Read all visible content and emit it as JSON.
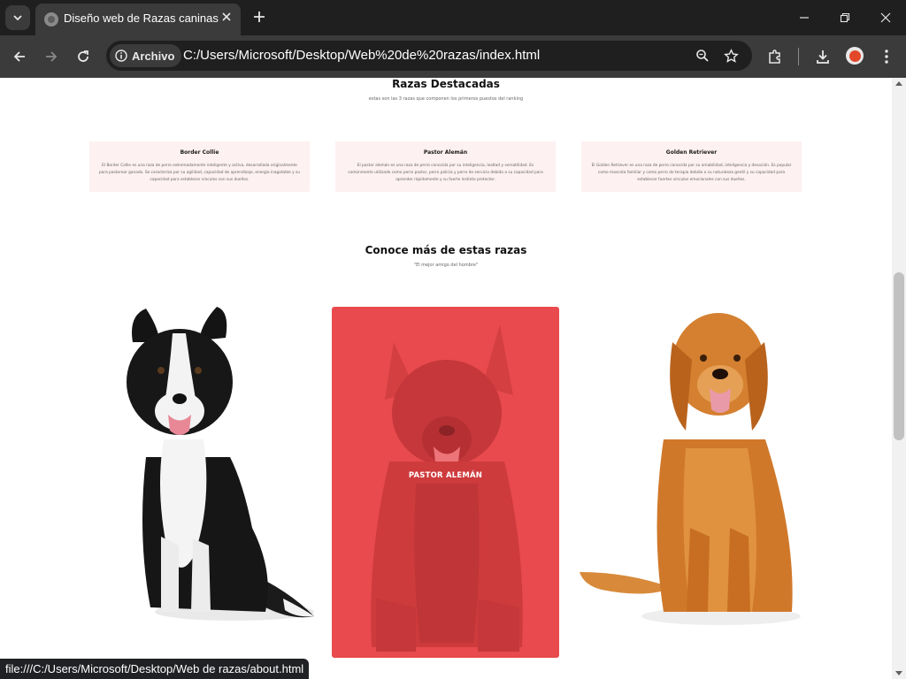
{
  "browser": {
    "tab_title": "Diseño web de Razas caninas",
    "site_chip_label": "Archivo",
    "url": "C:/Users/Microsoft/Desktop/Web%20de%20razas/index.html",
    "status_url": "file:///C:/Users/Microsoft/Desktop/Web de razas/about.html",
    "icons": [
      "tab-search-icon",
      "close-icon",
      "plus-icon",
      "minimize-icon",
      "restore-icon",
      "back-icon",
      "forward-icon",
      "reload-icon",
      "info-icon",
      "zoom-icon",
      "star-icon",
      "extensions-icon",
      "download-icon",
      "more-icon"
    ]
  },
  "page": {
    "featured_section": {
      "title": "Razas Destacadas",
      "subtitle": "estas son las 3 razas que componen los primeros puestos del ranking",
      "cards": [
        {
          "title": "Border Collie",
          "text": "El Border Collie es una raza de perro extremadamente inteligente y activa, desarrollada originalmente para pastorear ganado. Se caracteriza por su agilidad, capacidad de aprendizaje, energía inagotable y su capacidad para establecer vínculos con sus dueños."
        },
        {
          "title": "Pastor Alemán",
          "text": "El pastor alemán es una raza de perro conocida por su inteligencia, lealtad y versatilidad. Es comúnmente utilizado como perro pastor, perro policía y perro de servicio debido a su capacidad para aprender rápidamente y su fuerte instinto protector."
        },
        {
          "title": "Golden Retriever",
          "text": "El Golden Retriever es una raza de perro conocida por su amabilidad, inteligencia y devoción. Es popular como mascota familiar y como perro de terapia debido a su naturaleza gentil y su capacidad para establecer fuertes vínculos emocionales con sus dueños."
        }
      ]
    },
    "more_section": {
      "title": "Conoce más de estas razas",
      "subtitle": "\"El mejor amigo del hombre\"",
      "gallery": [
        {
          "name": "border-collie",
          "overlay_label": ""
        },
        {
          "name": "pastor-aleman",
          "overlay_label": "PASTOR ALEMÁN"
        },
        {
          "name": "golden-retriever",
          "overlay_label": ""
        }
      ]
    },
    "colors": {
      "card_bg": "#fdf1f1",
      "overlay_red": "#e84b4d"
    }
  }
}
